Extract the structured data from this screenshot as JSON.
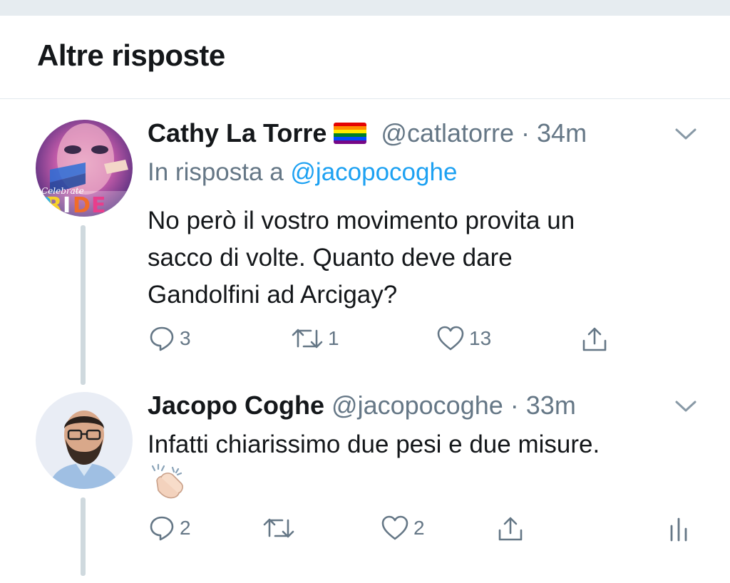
{
  "header": {
    "title": "Altre risposte"
  },
  "tweets": [
    {
      "name": "Cathy La Torre",
      "handle": "@catlatorre",
      "time": "· 34m",
      "reply_prefix": "In risposta a",
      "reply_mention": "@jacopocoghe",
      "text_lines": [
        "No però il vostro movimento provita un",
        "sacco di volte. Quanto deve dare",
        "Gandolfini ad Arcigay?"
      ],
      "replies": "3",
      "retweets": "1",
      "likes": "13",
      "avatar_text": "Celebrate PRIDE"
    },
    {
      "name": "Jacopo Coghe",
      "handle": "@jacopocoghe",
      "time": "· 33m",
      "text_lines": [
        "Infatti chiarissimo due pesi e due misure."
      ],
      "emoji": "clapping-hands",
      "replies": "2",
      "retweets": "",
      "likes": "2"
    }
  ],
  "colors": {
    "accent": "#1da1f2",
    "muted": "#657786",
    "divider": "#e1e8ed"
  }
}
